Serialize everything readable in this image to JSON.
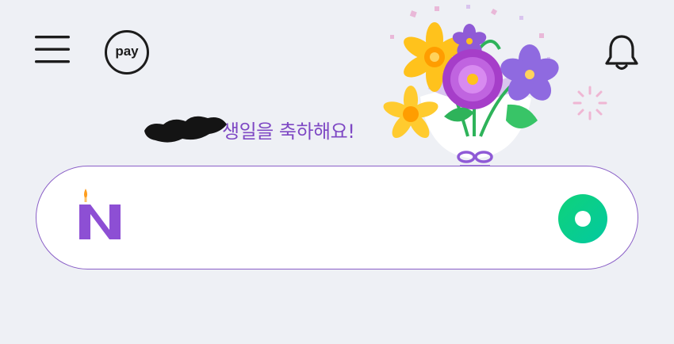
{
  "header": {
    "menu_icon": "hamburger-menu-icon",
    "pay_label": "pay",
    "bell_icon": "bell-icon"
  },
  "greeting": {
    "text": "생일을 축하해요!"
  },
  "search": {
    "value": "",
    "placeholder": ""
  },
  "colors": {
    "background": "#eef0f5",
    "accent_purple": "#7e48c4",
    "green": "#03c75a",
    "border": "#8a5fc7"
  }
}
